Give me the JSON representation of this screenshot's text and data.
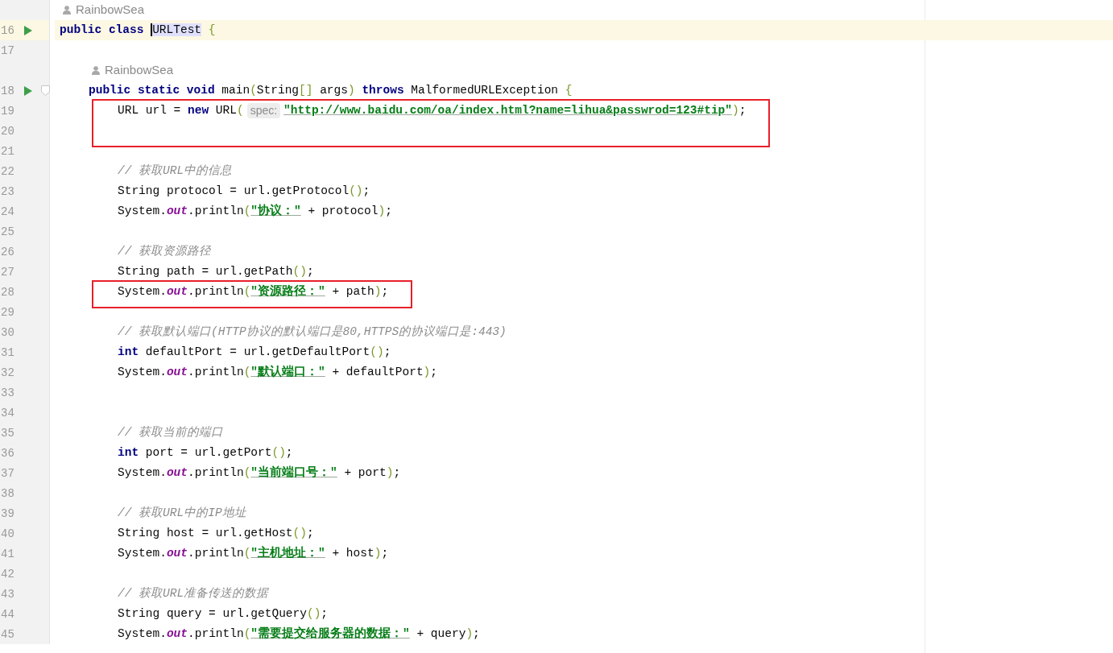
{
  "lines": [
    {
      "kind": "author",
      "author": "RainbowSea"
    },
    {
      "kind": "code",
      "number": "16",
      "run": true,
      "current": true,
      "tokens": [
        {
          "kind": "kw",
          "text": "public class "
        },
        {
          "kind": "sel",
          "text": "URLTest",
          "caret": true
        },
        {
          "kind": "paren",
          "text": " {"
        }
      ],
      "children": [
        {
          "kind": "code",
          "number": "17",
          "run": false,
          "current": false
        },
        {
          "kind": "author",
          "author": "RainbowSea"
        },
        {
          "kind": "code",
          "number": "18",
          "run": true,
          "current": false,
          "fold": true,
          "tokens": [
            {
              "kind": "kw",
              "text": "public static void "
            },
            {
              "kind": "plain",
              "text": "main"
            },
            {
              "kind": "paren",
              "text": "("
            },
            {
              "kind": "plain",
              "text": "String"
            },
            {
              "kind": "paren",
              "text": "[]"
            },
            {
              "kind": "plain",
              "text": " args"
            },
            {
              "kind": "paren",
              "text": ")"
            },
            {
              "kind": "kw",
              "text": " throws"
            },
            {
              "kind": "plain",
              "text": " MalformedURLException "
            },
            {
              "kind": "paren",
              "text": "{"
            }
          ],
          "children": [
            {
              "kind": "code",
              "number": "19",
              "run": false,
              "current": false,
              "boxed": true,
              "tokens": [
                {
                  "kind": "plain",
                  "text": "URL url = "
                },
                {
                  "kind": "kw",
                  "text": "new"
                },
                {
                  "kind": "plain",
                  "text": " URL"
                },
                {
                  "kind": "paren",
                  "text": "("
                },
                {
                  "kind": "hint",
                  "text": "spec:"
                },
                {
                  "kind": "str",
                  "text": "\"http://www.baidu.com/oa/index.html?name=lihua&passwrod=123#tip\""
                },
                {
                  "kind": "paren",
                  "text": ")"
                },
                {
                  "kind": "plain",
                  "text": ";"
                }
              ]
            },
            {
              "kind": "code",
              "number": "20",
              "run": false,
              "current": false,
              "boxed": true
            },
            {
              "kind": "code",
              "number": "21",
              "run": false,
              "current": false
            },
            {
              "kind": "code",
              "number": "22",
              "run": false,
              "current": false,
              "tokens": [
                {
                  "kind": "comment",
                  "text": "// 获取URL中的信息"
                }
              ]
            },
            {
              "kind": "code",
              "number": "23",
              "run": false,
              "current": false,
              "tokens": [
                {
                  "kind": "plain",
                  "text": "String protocol = url.getProtocol"
                },
                {
                  "kind": "paren",
                  "text": "()"
                },
                {
                  "kind": "plain",
                  "text": ";"
                }
              ]
            },
            {
              "kind": "code",
              "number": "24",
              "run": false,
              "current": false,
              "tokens": [
                {
                  "kind": "plain",
                  "text": "System."
                },
                {
                  "kind": "field",
                  "text": "out"
                },
                {
                  "kind": "plain",
                  "text": ".println"
                },
                {
                  "kind": "paren",
                  "text": "("
                },
                {
                  "kind": "str",
                  "text": "\"协议：\""
                },
                {
                  "kind": "plain",
                  "text": " + protocol"
                },
                {
                  "kind": "paren",
                  "text": ")"
                },
                {
                  "kind": "plain",
                  "text": ";"
                }
              ]
            },
            {
              "kind": "code",
              "number": "25",
              "run": false,
              "current": false
            },
            {
              "kind": "code",
              "number": "26",
              "run": false,
              "current": false,
              "tokens": [
                {
                  "kind": "comment",
                  "text": "// 获取资源路径"
                }
              ]
            },
            {
              "kind": "code",
              "number": "27",
              "run": false,
              "current": false,
              "tokens": [
                {
                  "kind": "plain",
                  "text": "String path = url.getPath"
                },
                {
                  "kind": "paren",
                  "text": "()"
                },
                {
                  "kind": "plain",
                  "text": ";"
                }
              ]
            },
            {
              "kind": "code",
              "number": "28",
              "run": false,
              "current": false,
              "boxed": true,
              "tokens": [
                {
                  "kind": "plain",
                  "text": "System."
                },
                {
                  "kind": "field",
                  "text": "out"
                },
                {
                  "kind": "plain",
                  "text": ".println"
                },
                {
                  "kind": "paren",
                  "text": "("
                },
                {
                  "kind": "str",
                  "text": "\"资源路径：\""
                },
                {
                  "kind": "plain",
                  "text": " + path"
                },
                {
                  "kind": "paren",
                  "text": ")"
                },
                {
                  "kind": "plain",
                  "text": ";"
                }
              ]
            },
            {
              "kind": "code",
              "number": "29",
              "run": false,
              "current": false
            },
            {
              "kind": "code",
              "number": "30",
              "run": false,
              "current": false,
              "tokens": [
                {
                  "kind": "comment",
                  "text": "// 获取默认端口(HTTP协议的默认端口是80,HTTPS的协议端口是:443)"
                }
              ]
            },
            {
              "kind": "code",
              "number": "31",
              "run": false,
              "current": false,
              "tokens": [
                {
                  "kind": "kw",
                  "text": "int"
                },
                {
                  "kind": "plain",
                  "text": " defaultPort = url.getDefaultPort"
                },
                {
                  "kind": "paren",
                  "text": "()"
                },
                {
                  "kind": "plain",
                  "text": ";"
                }
              ]
            },
            {
              "kind": "code",
              "number": "32",
              "run": false,
              "current": false,
              "tokens": [
                {
                  "kind": "plain",
                  "text": "System."
                },
                {
                  "kind": "field",
                  "text": "out"
                },
                {
                  "kind": "plain",
                  "text": ".println"
                },
                {
                  "kind": "paren",
                  "text": "("
                },
                {
                  "kind": "str",
                  "text": "\"默认端口：\""
                },
                {
                  "kind": "plain",
                  "text": " + defaultPort"
                },
                {
                  "kind": "paren",
                  "text": ")"
                },
                {
                  "kind": "plain",
                  "text": ";"
                }
              ]
            },
            {
              "kind": "code",
              "number": "33",
              "run": false,
              "current": false
            },
            {
              "kind": "code",
              "number": "34",
              "run": false,
              "current": false
            },
            {
              "kind": "code",
              "number": "35",
              "run": false,
              "current": false,
              "tokens": [
                {
                  "kind": "comment",
                  "text": "// 获取当前的端口"
                }
              ]
            },
            {
              "kind": "code",
              "number": "36",
              "run": false,
              "current": false,
              "tokens": [
                {
                  "kind": "kw",
                  "text": "int"
                },
                {
                  "kind": "plain",
                  "text": " port = url.getPort"
                },
                {
                  "kind": "paren",
                  "text": "()"
                },
                {
                  "kind": "plain",
                  "text": ";"
                }
              ]
            },
            {
              "kind": "code",
              "number": "37",
              "run": false,
              "current": false,
              "tokens": [
                {
                  "kind": "plain",
                  "text": "System."
                },
                {
                  "kind": "field",
                  "text": "out"
                },
                {
                  "kind": "plain",
                  "text": ".println"
                },
                {
                  "kind": "paren",
                  "text": "("
                },
                {
                  "kind": "str",
                  "text": "\"当前端口号：\""
                },
                {
                  "kind": "plain",
                  "text": " + port"
                },
                {
                  "kind": "paren",
                  "text": ")"
                },
                {
                  "kind": "plain",
                  "text": ";"
                }
              ]
            },
            {
              "kind": "code",
              "number": "38",
              "run": false,
              "current": false
            },
            {
              "kind": "code",
              "number": "39",
              "run": false,
              "current": false,
              "tokens": [
                {
                  "kind": "comment",
                  "text": "// 获取URL中的IP地址"
                }
              ]
            },
            {
              "kind": "code",
              "number": "40",
              "run": false,
              "current": false,
              "tokens": [
                {
                  "kind": "plain",
                  "text": "String host = url.getHost"
                },
                {
                  "kind": "paren",
                  "text": "()"
                },
                {
                  "kind": "plain",
                  "text": ";"
                }
              ]
            },
            {
              "kind": "code",
              "number": "41",
              "run": false,
              "current": false,
              "tokens": [
                {
                  "kind": "plain",
                  "text": "System."
                },
                {
                  "kind": "field",
                  "text": "out"
                },
                {
                  "kind": "plain",
                  "text": ".println"
                },
                {
                  "kind": "paren",
                  "text": "("
                },
                {
                  "kind": "str",
                  "text": "\"主机地址：\""
                },
                {
                  "kind": "plain",
                  "text": " + host"
                },
                {
                  "kind": "paren",
                  "text": ")"
                },
                {
                  "kind": "plain",
                  "text": ";"
                }
              ]
            },
            {
              "kind": "code",
              "number": "42",
              "run": false,
              "current": false
            },
            {
              "kind": "code",
              "number": "43",
              "run": false,
              "current": false,
              "tokens": [
                {
                  "kind": "comment",
                  "text": "// 获取URL准备传送的数据"
                }
              ]
            },
            {
              "kind": "code",
              "number": "44",
              "run": false,
              "current": false,
              "tokens": [
                {
                  "kind": "plain",
                  "text": "String query = url.getQuery"
                },
                {
                  "kind": "paren",
                  "text": "()"
                },
                {
                  "kind": "plain",
                  "text": ";"
                }
              ]
            },
            {
              "kind": "code",
              "number": "45",
              "run": false,
              "current": false,
              "tokens": [
                {
                  "kind": "plain",
                  "text": "System."
                },
                {
                  "kind": "field",
                  "text": "out"
                },
                {
                  "kind": "plain",
                  "text": ".println"
                },
                {
                  "kind": "paren",
                  "text": "("
                },
                {
                  "kind": "str",
                  "text": "\"需要提交给服务器的数据：\""
                },
                {
                  "kind": "plain",
                  "text": " + query"
                },
                {
                  "kind": "paren",
                  "text": ")"
                },
                {
                  "kind": "plain",
                  "text": ";"
                }
              ]
            }
          ]
        }
      ]
    }
  ]
}
